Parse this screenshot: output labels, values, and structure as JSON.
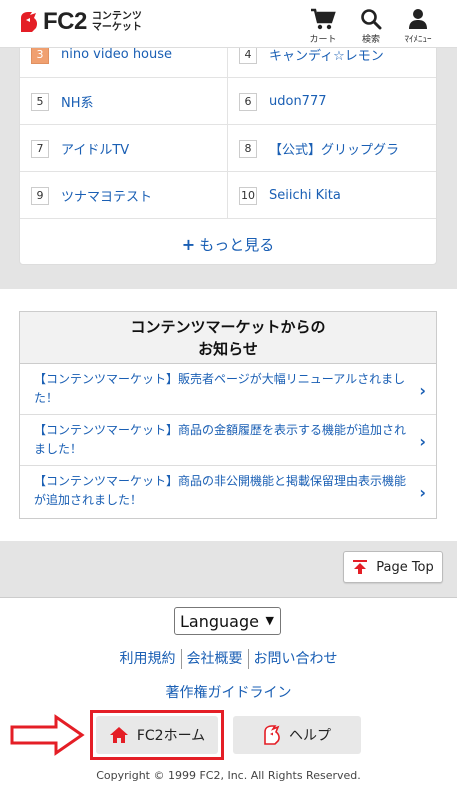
{
  "header": {
    "logo_text": "FC2",
    "logo_sub_line1": "コンテンツ",
    "logo_sub_line2": "マーケット",
    "cart_label": "カート",
    "search_label": "検索",
    "mymenu_label": "ﾏｲﾒﾆｭｰ"
  },
  "ranking": {
    "rows": [
      {
        "left": {
          "num": "3",
          "name": "nino video house"
        },
        "right": {
          "num": "4",
          "name": "キャンディ☆レモン"
        }
      },
      {
        "left": {
          "num": "5",
          "name": "NH系"
        },
        "right": {
          "num": "6",
          "name": "udon777"
        }
      },
      {
        "left": {
          "num": "7",
          "name": "アイドルTV"
        },
        "right": {
          "num": "8",
          "name": "【公式】グリップグラ"
        }
      },
      {
        "left": {
          "num": "9",
          "name": "ツナマヨテスト"
        },
        "right": {
          "num": "10",
          "name": "Seiichi Kita"
        }
      }
    ],
    "more_plus": "+",
    "more_label": "もっと見る"
  },
  "news": {
    "title_line1": "コンテンツマーケットからの",
    "title_line2": "お知らせ",
    "items": [
      "【コンテンツマーケット】販売者ページが大幅リニューアルされました！",
      "【コンテンツマーケット】商品の金額履歴を表示する機能が追加されました！",
      "【コンテンツマーケット】商品の非公開機能と掲載保留理由表示機能が追加されました！"
    ],
    "chevron": "›"
  },
  "page_top_label": "Page Top",
  "footer": {
    "language_selected": "Language",
    "links": [
      "利用規約",
      "会社概要",
      "お問い合わせ"
    ],
    "guideline": "著作権ガイドライン",
    "home_label": "FC2ホーム",
    "help_label": "ヘルプ",
    "copyright": "Copyright © 1999 FC2, Inc. All Rights Reserved."
  },
  "colors": {
    "link": "#1a5fb4",
    "highlight": "#e41e26",
    "home_icon": "#e41e26"
  },
  "icons": [
    "fc2-logo-icon",
    "cart-icon",
    "search-icon",
    "user-icon",
    "chevron-right-icon",
    "page-top-icon",
    "home-icon",
    "fc2-help-icon",
    "red-arrow-icon"
  ]
}
